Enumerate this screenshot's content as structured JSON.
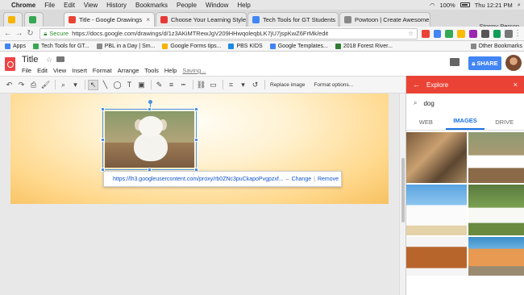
{
  "mac_menu": {
    "items": [
      "Chrome",
      "File",
      "Edit",
      "View",
      "History",
      "Bookmarks",
      "People",
      "Window",
      "Help"
    ],
    "clock": "Thu 12:21 PM",
    "battery": "100%"
  },
  "tabs": [
    {
      "label": "",
      "favicon_color": "#f4b400"
    },
    {
      "label": "",
      "favicon_color": "#34a853"
    },
    {
      "label": "Title - Google Drawings",
      "favicon_color": "#ea4335"
    },
    {
      "label": "Choose Your Learning Style",
      "favicon_color": "#e53935"
    },
    {
      "label": "Tech Tools for GT Students",
      "favicon_color": "#4285f4"
    },
    {
      "label": "Powtoon | Create Awesome V",
      "favicon_color": "#888888"
    }
  ],
  "profile_name": "Stormy Person",
  "address": {
    "secure_label": "Secure",
    "url": "https://docs.google.com/drawings/d/1z3AKiMTRewJgV209HHwqoleqbLK7jU7jspKwZ6FrMk/edit"
  },
  "bookmarks": [
    "Apps",
    "Tech Tools for GT...",
    "PBL in a Day | Sm...",
    "Google Forms tips...",
    "PBS KIDS",
    "Google Templates...",
    "2018 Forest River..."
  ],
  "bookmarks_other": "Other Bookmarks",
  "doc": {
    "title": "Title",
    "menu": [
      "File",
      "Edit",
      "View",
      "Insert",
      "Format",
      "Arrange",
      "Tools",
      "Help"
    ],
    "saving": "Saving...",
    "share": "SHARE"
  },
  "toolbar": {
    "replace_image": "Replace image",
    "format_options": "Format options..."
  },
  "link_bubble": {
    "url": "https://lh3.googleusercontent.com/proxy/rb0ZNc3puCkapoPvgpzxf...",
    "separator": "–",
    "change": "Change",
    "remove": "Remove"
  },
  "explore": {
    "title": "Explore",
    "query": "dog",
    "tabs": [
      "WEB",
      "IMAGES",
      "DRIVE"
    ],
    "active_tab": "IMAGES"
  },
  "colors": {
    "accent_red": "#ea4335",
    "share_blue": "#4285f4",
    "selection_blue": "#4a90e2"
  }
}
